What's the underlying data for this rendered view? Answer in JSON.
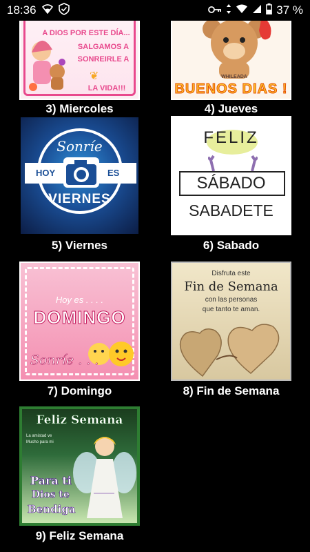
{
  "status_bar": {
    "time": "18:36",
    "battery": "37 %",
    "icons": [
      "wifi-icon",
      "shield-check-icon",
      "key-icon",
      "data-arrows-icon",
      "wifi-signal-icon",
      "cell-signal-icon",
      "battery-icon"
    ]
  },
  "items": [
    {
      "caption": "3) Miercoles",
      "lines": [
        "A DIOS POR ESTE DÍA...",
        "SALGAMOS A",
        "SONREIRLE A",
        "LA VIDA!!!"
      ]
    },
    {
      "caption": "4) Jueves",
      "lines": [
        "BUENOS DIAS !",
        "WHILEADA"
      ]
    },
    {
      "caption": "5) Viernes",
      "lines": [
        "Sonríe",
        "HOY",
        "ES",
        "VIERNES"
      ]
    },
    {
      "caption": "6) Sabado",
      "lines": [
        "FELIZ",
        "SÁBADO",
        "SABADETE"
      ]
    },
    {
      "caption": "7) Domingo",
      "lines": [
        "Hoy es . . . .",
        "DOMINGO",
        "Sonríe . . ."
      ]
    },
    {
      "caption": "8) Fin de Semana",
      "lines": [
        "Disfruta este",
        "Fin de Semana",
        "con las personas",
        "que tanto te aman."
      ]
    },
    {
      "caption": "9) Feliz Semana",
      "lines": [
        "Feliz Semana",
        "La amistad ve",
        "Mucho para mi",
        "Para ti",
        "Dios te",
        "Bendiga"
      ]
    }
  ],
  "colors": {
    "background": "#000000",
    "border": "#ffffff"
  }
}
